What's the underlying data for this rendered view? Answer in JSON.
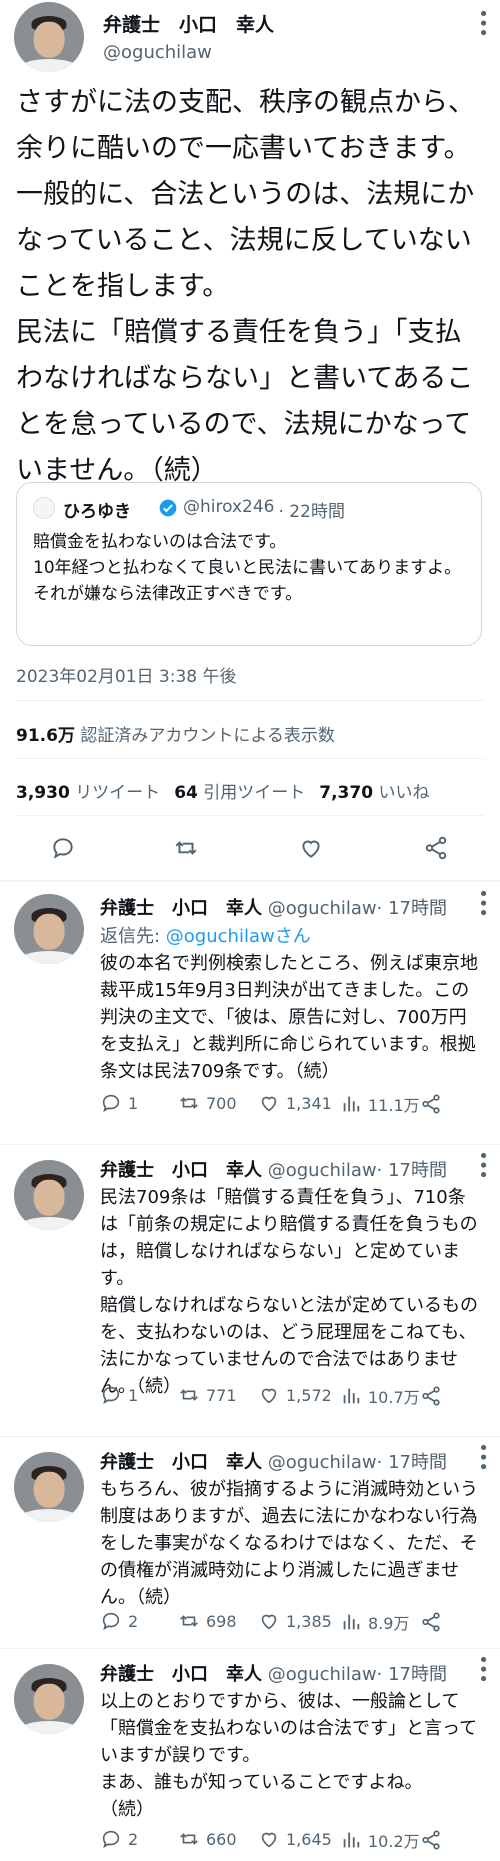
{
  "main_tweet": {
    "display_name": "弁護士　小口　幸人",
    "handle": "@oguchilaw",
    "body": "さすがに法の支配、秩序の観点から、余りに酷いので一応書いておきます。\n一般的に、合法というのは、法規にかなっていること、法規に反していないことを指します。\n民法に「賠償する責任を負う」「支払わなければならない」と書いてあることを怠っているので、法規にかなっていません。（続）",
    "quoted": {
      "display_name": "ひろゆき",
      "handle": "@hirox246",
      "time": "· 22時間",
      "body": "賠償金を払わないのは合法です。\n10年経つと払わなくて良いと民法に書いてありますよ。\nそれが嫌なら法律改正すべきです。"
    },
    "timestamp": "2023年02月01日 3:38 午後",
    "views_num": "91.6万",
    "views_label": "認証済みアカウントによる表示数",
    "retweets_num": "3,930",
    "retweets_label": "リツイート",
    "quotes_num": "64",
    "quotes_label": "引用ツイート",
    "likes_num": "7,370",
    "likes_label": "いいね"
  },
  "replies": [
    {
      "display_name": "弁護士　小口　幸人",
      "handle": "@oguchilaw",
      "time": "· 17時間",
      "reply_prefix": "返信先: ",
      "reply_target": "@oguchilawさん",
      "body": "彼の本名で判例検索したところ、例えば東京地裁平成15年9月3日判決が出てきました。この判決の主文で、「彼は、原告に対し、700万円を支払え」と裁判所に命じられています。根拠条文は民法709条です。（続）",
      "replies": "1",
      "retweets": "700",
      "likes": "1,341",
      "views": "11.1万"
    },
    {
      "display_name": "弁護士　小口　幸人",
      "handle": "@oguchilaw",
      "time": "· 17時間",
      "body": "民法709条は「賠償する責任を負う」、710条は「前条の規定により賠償する責任を負うものは，賠償しなければならない」と定めています。\n賠償しなければならないと法が定めているものを、支払わないのは、どう屁理屈をこねても、法にかなっていませんので合法ではありません。（続）",
      "replies": "1",
      "retweets": "771",
      "likes": "1,572",
      "views": "10.7万"
    },
    {
      "display_name": "弁護士　小口　幸人",
      "handle": "@oguchilaw",
      "time": "· 17時間",
      "body": "もちろん、彼が指摘するように消滅時効という制度はありますが、過去に法にかなわない行為をした事実がなくなるわけではなく、ただ、その債権が消滅時効により消滅したに過ぎません。（続）",
      "replies": "2",
      "retweets": "698",
      "likes": "1,385",
      "views": "8.9万"
    },
    {
      "display_name": "弁護士　小口　幸人",
      "handle": "@oguchilaw",
      "time": "· 17時間",
      "body": "以上のとおりですから、彼は、一般論として「賠償金を支払わないのは合法です」と言っていますが誤りです。\nまあ、誰もが知っていることですよね。\n（続）",
      "replies": "2",
      "retweets": "660",
      "likes": "1,645",
      "views": "10.2万"
    }
  ],
  "icons": [
    "more-icon",
    "reply-icon",
    "retweet-icon",
    "like-icon",
    "share-icon",
    "views-icon",
    "verified-icon"
  ],
  "colors": {
    "accent": "#1d9bf0",
    "text": "#0f1419",
    "secondary": "#536471",
    "border": "#cfd9de"
  }
}
